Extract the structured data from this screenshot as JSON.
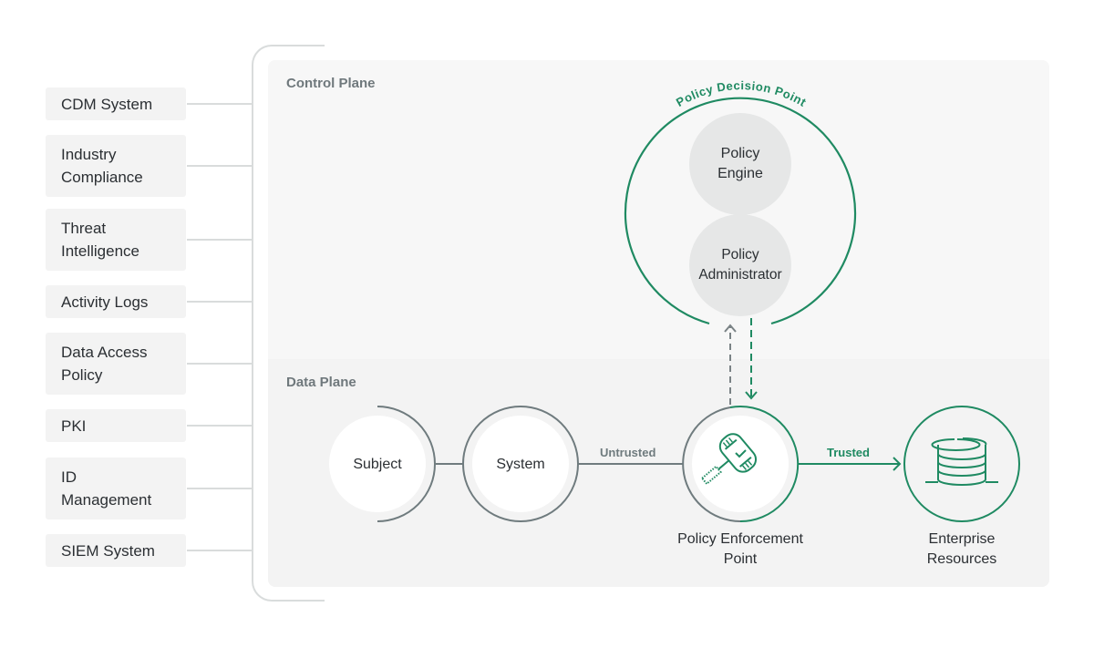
{
  "colors": {
    "accent_green": "#1f8a62",
    "neutral_gray": "#6f7b7e",
    "source_box_bg": "#f3f3f3",
    "connector": "#d9dcdc",
    "node_fill_gray": "#e6e7e7"
  },
  "sources": [
    {
      "label": "CDM System"
    },
    {
      "label": "Industry Compliance"
    },
    {
      "label": "Threat Intelligence"
    },
    {
      "label": "Activity Logs"
    },
    {
      "label": "Data Access Policy"
    },
    {
      "label": "PKI"
    },
    {
      "label": "ID Management"
    },
    {
      "label": "SIEM System"
    }
  ],
  "planes": {
    "control": "Control Plane",
    "data": "Data Plane"
  },
  "pdp": {
    "title": "Policy Decision Point",
    "engine": "Policy Engine",
    "administrator": "Policy Administrator"
  },
  "data_plane": {
    "subject": "Subject",
    "system": "System",
    "untrusted": "Untrusted",
    "pep": "Policy Enforcement Point",
    "trusted": "Trusted",
    "resources": "Enterprise Resources",
    "pep_icon": "gavel-check-icon",
    "resources_icon": "database-icon"
  }
}
